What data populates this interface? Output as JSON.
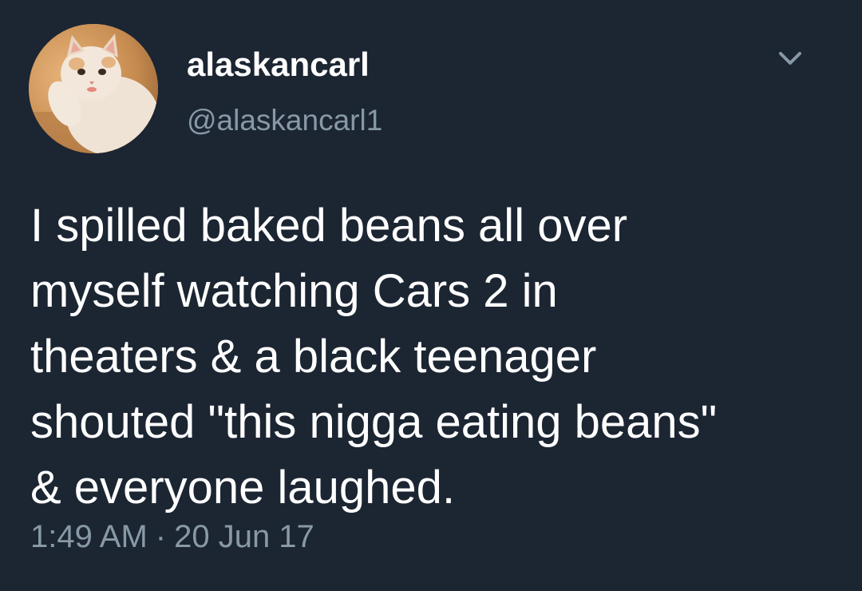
{
  "tweet": {
    "display_name": "alaskancarl",
    "handle": "@alaskancarl1",
    "avatar_icon": "cat-avatar-icon",
    "menu_icon": "chevron-down-icon",
    "text": "I spilled baked beans all over\nmyself watching Cars 2 in\ntheaters & a black teenager\nshouted \"this nigga eating beans\"\n& everyone laughed.",
    "time": "1:49 AM",
    "separator": "·",
    "date": "20 Jun 17"
  },
  "colors": {
    "background": "#1c2532",
    "primary_text": "#ffffff",
    "secondary_text": "#8899a6"
  }
}
